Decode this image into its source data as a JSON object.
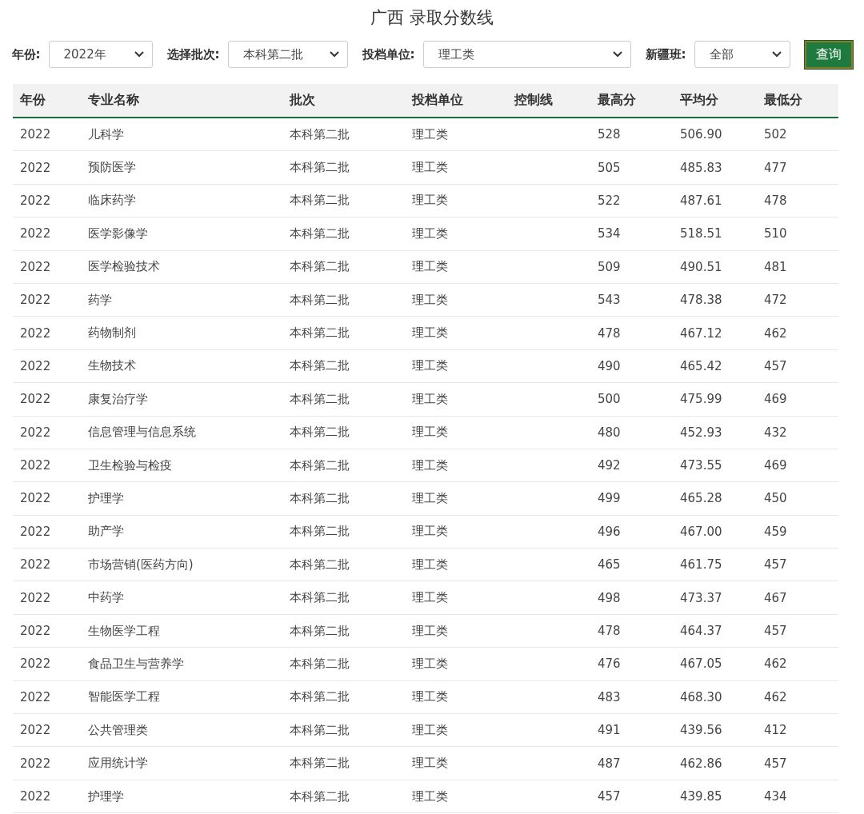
{
  "title": "广西 录取分数线",
  "filters": [
    {
      "label": "年份:",
      "value": "2022年"
    },
    {
      "label": "选择批次:",
      "value": "本科第二批"
    },
    {
      "label": "投档单位:",
      "value": "理工类"
    },
    {
      "label": "新疆班:",
      "value": "全部"
    }
  ],
  "query_button": "查询",
  "table": {
    "columns": [
      "年份",
      "专业名称",
      "批次",
      "投档单位",
      "控制线",
      "最高分",
      "平均分",
      "最低分"
    ],
    "rows": [
      [
        "2022",
        "儿科学",
        "本科第二批",
        "理工类",
        "",
        "528",
        "506.90",
        "502"
      ],
      [
        "2022",
        "预防医学",
        "本科第二批",
        "理工类",
        "",
        "505",
        "485.83",
        "477"
      ],
      [
        "2022",
        "临床药学",
        "本科第二批",
        "理工类",
        "",
        "522",
        "487.61",
        "478"
      ],
      [
        "2022",
        "医学影像学",
        "本科第二批",
        "理工类",
        "",
        "534",
        "518.51",
        "510"
      ],
      [
        "2022",
        "医学检验技术",
        "本科第二批",
        "理工类",
        "",
        "509",
        "490.51",
        "481"
      ],
      [
        "2022",
        "药学",
        "本科第二批",
        "理工类",
        "",
        "543",
        "478.38",
        "472"
      ],
      [
        "2022",
        "药物制剂",
        "本科第二批",
        "理工类",
        "",
        "478",
        "467.12",
        "462"
      ],
      [
        "2022",
        "生物技术",
        "本科第二批",
        "理工类",
        "",
        "490",
        "465.42",
        "457"
      ],
      [
        "2022",
        "康复治疗学",
        "本科第二批",
        "理工类",
        "",
        "500",
        "475.99",
        "469"
      ],
      [
        "2022",
        "信息管理与信息系统",
        "本科第二批",
        "理工类",
        "",
        "480",
        "452.93",
        "432"
      ],
      [
        "2022",
        "卫生检验与检疫",
        "本科第二批",
        "理工类",
        "",
        "492",
        "473.55",
        "469"
      ],
      [
        "2022",
        "护理学",
        "本科第二批",
        "理工类",
        "",
        "499",
        "465.28",
        "450"
      ],
      [
        "2022",
        "助产学",
        "本科第二批",
        "理工类",
        "",
        "496",
        "467.00",
        "459"
      ],
      [
        "2022",
        "市场营销(医药方向)",
        "本科第二批",
        "理工类",
        "",
        "465",
        "461.75",
        "457"
      ],
      [
        "2022",
        "中药学",
        "本科第二批",
        "理工类",
        "",
        "498",
        "473.37",
        "467"
      ],
      [
        "2022",
        "生物医学工程",
        "本科第二批",
        "理工类",
        "",
        "478",
        "464.37",
        "457"
      ],
      [
        "2022",
        "食品卫生与营养学",
        "本科第二批",
        "理工类",
        "",
        "476",
        "467.05",
        "462"
      ],
      [
        "2022",
        "智能医学工程",
        "本科第二批",
        "理工类",
        "",
        "483",
        "468.30",
        "462"
      ],
      [
        "2022",
        "公共管理类",
        "本科第二批",
        "理工类",
        "",
        "491",
        "439.56",
        "412"
      ],
      [
        "2022",
        "应用统计学",
        "本科第二批",
        "理工类",
        "",
        "487",
        "462.86",
        "457"
      ],
      [
        "2022",
        "护理学",
        "本科第二批",
        "理工类",
        "",
        "457",
        "439.85",
        "434"
      ]
    ]
  }
}
